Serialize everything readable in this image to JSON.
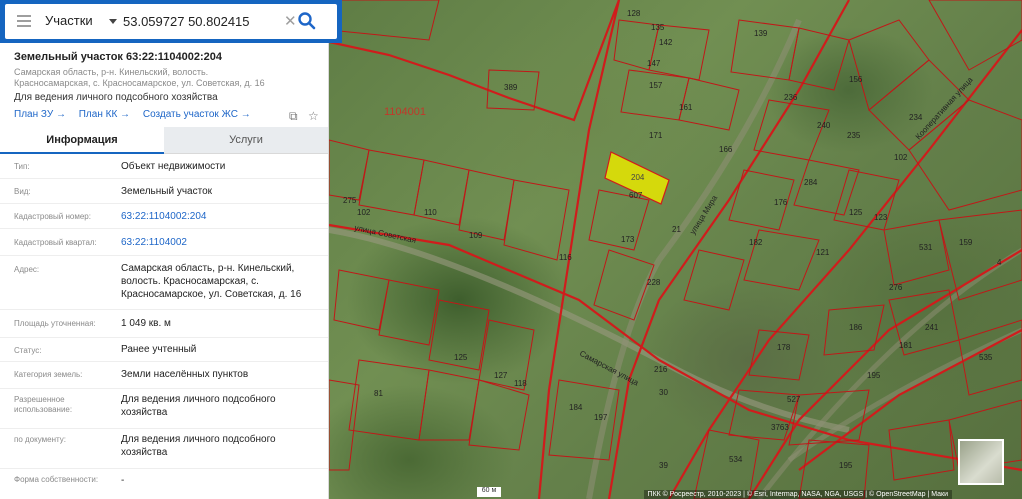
{
  "search": {
    "type_label": "Участки",
    "query": "53.059727 50.802415"
  },
  "parcel": {
    "title": "Земельный участок 63:22:1104002:204",
    "address": "Самарская область, р-н. Кинельский, волость. Красносамарская, с. Красносамарское, ул. Советская, д. 16",
    "purpose": "Для ведения личного подсобного хозяйства"
  },
  "links": {
    "plan_zu": "План ЗУ →",
    "plan_kk": "План КК →",
    "create_zhs": "Создать участок ЖС →"
  },
  "tabs": {
    "info": "Информация",
    "services": "Услуги"
  },
  "rows": [
    {
      "label": "Тип:",
      "value": "Объект недвижимости"
    },
    {
      "label": "Вид:",
      "value": "Земельный участок"
    },
    {
      "label": "Кадастровый номер:",
      "value": "63:22:1104002:204"
    },
    {
      "label": "Кадастровый квартал:",
      "value": "63:22:1104002"
    },
    {
      "label": "Адрес:",
      "value": "Самарская область, р-н. Кинельский, волость. Красносамарская, с. Красносамарское, ул. Советская, д. 16"
    },
    {
      "label": "Площадь уточненная:",
      "value": "1 049 кв. м"
    },
    {
      "label": "Статус:",
      "value": "Ранее учтенный"
    },
    {
      "label": "Категория земель:",
      "value": "Земли населённых пунктов"
    },
    {
      "label": "Разрешенное использование:",
      "value": "Для ведения личного подсобного хозяйства"
    },
    {
      "label": "по документу:",
      "value": "Для ведения личного подсобного хозяйства"
    },
    {
      "label": "Форма собственности:",
      "value": "-"
    }
  ],
  "map": {
    "quarter_label": "1104001",
    "highlight_color": "#e8e600",
    "boundary_color": "#d01c1c",
    "scale_label": "60 м",
    "attribution": "ПКК © Росреестр, 2010-2023 | © Esri, Intermap, NASA, NGA, USGS | © OpenStreetMap | Маки",
    "street_labels": [
      "улица Советская",
      "Самарская улица",
      "Кооперативная улица",
      "улица Мира"
    ],
    "parcel_numbers": [
      "389",
      "128",
      "135",
      "142",
      "147",
      "157",
      "161",
      "171",
      "166",
      "156",
      "139",
      "236",
      "240",
      "235",
      "234",
      "284",
      "176",
      "125",
      "123",
      "102",
      "275",
      "102",
      "110",
      "109",
      "116",
      "173",
      "21",
      "607",
      "204",
      "182",
      "228",
      "121",
      "159",
      "531",
      "276",
      "241",
      "186",
      "181",
      "178",
      "195",
      "535",
      "527",
      "3763",
      "534",
      "195",
      "30",
      "39",
      "81",
      "125",
      "127",
      "118",
      "184",
      "197",
      "216",
      "4"
    ]
  }
}
